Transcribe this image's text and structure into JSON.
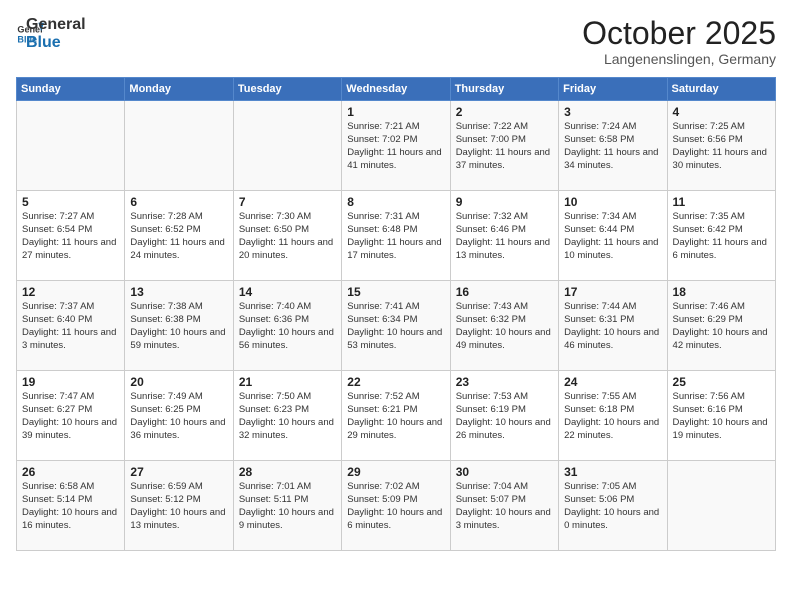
{
  "header": {
    "logo_general": "General",
    "logo_blue": "Blue",
    "month": "October 2025",
    "location": "Langenenslingen, Germany"
  },
  "days_of_week": [
    "Sunday",
    "Monday",
    "Tuesday",
    "Wednesday",
    "Thursday",
    "Friday",
    "Saturday"
  ],
  "weeks": [
    [
      {
        "day": "",
        "info": ""
      },
      {
        "day": "",
        "info": ""
      },
      {
        "day": "",
        "info": ""
      },
      {
        "day": "1",
        "info": "Sunrise: 7:21 AM\nSunset: 7:02 PM\nDaylight: 11 hours and 41 minutes."
      },
      {
        "day": "2",
        "info": "Sunrise: 7:22 AM\nSunset: 7:00 PM\nDaylight: 11 hours and 37 minutes."
      },
      {
        "day": "3",
        "info": "Sunrise: 7:24 AM\nSunset: 6:58 PM\nDaylight: 11 hours and 34 minutes."
      },
      {
        "day": "4",
        "info": "Sunrise: 7:25 AM\nSunset: 6:56 PM\nDaylight: 11 hours and 30 minutes."
      }
    ],
    [
      {
        "day": "5",
        "info": "Sunrise: 7:27 AM\nSunset: 6:54 PM\nDaylight: 11 hours and 27 minutes."
      },
      {
        "day": "6",
        "info": "Sunrise: 7:28 AM\nSunset: 6:52 PM\nDaylight: 11 hours and 24 minutes."
      },
      {
        "day": "7",
        "info": "Sunrise: 7:30 AM\nSunset: 6:50 PM\nDaylight: 11 hours and 20 minutes."
      },
      {
        "day": "8",
        "info": "Sunrise: 7:31 AM\nSunset: 6:48 PM\nDaylight: 11 hours and 17 minutes."
      },
      {
        "day": "9",
        "info": "Sunrise: 7:32 AM\nSunset: 6:46 PM\nDaylight: 11 hours and 13 minutes."
      },
      {
        "day": "10",
        "info": "Sunrise: 7:34 AM\nSunset: 6:44 PM\nDaylight: 11 hours and 10 minutes."
      },
      {
        "day": "11",
        "info": "Sunrise: 7:35 AM\nSunset: 6:42 PM\nDaylight: 11 hours and 6 minutes."
      }
    ],
    [
      {
        "day": "12",
        "info": "Sunrise: 7:37 AM\nSunset: 6:40 PM\nDaylight: 11 hours and 3 minutes."
      },
      {
        "day": "13",
        "info": "Sunrise: 7:38 AM\nSunset: 6:38 PM\nDaylight: 10 hours and 59 minutes."
      },
      {
        "day": "14",
        "info": "Sunrise: 7:40 AM\nSunset: 6:36 PM\nDaylight: 10 hours and 56 minutes."
      },
      {
        "day": "15",
        "info": "Sunrise: 7:41 AM\nSunset: 6:34 PM\nDaylight: 10 hours and 53 minutes."
      },
      {
        "day": "16",
        "info": "Sunrise: 7:43 AM\nSunset: 6:32 PM\nDaylight: 10 hours and 49 minutes."
      },
      {
        "day": "17",
        "info": "Sunrise: 7:44 AM\nSunset: 6:31 PM\nDaylight: 10 hours and 46 minutes."
      },
      {
        "day": "18",
        "info": "Sunrise: 7:46 AM\nSunset: 6:29 PM\nDaylight: 10 hours and 42 minutes."
      }
    ],
    [
      {
        "day": "19",
        "info": "Sunrise: 7:47 AM\nSunset: 6:27 PM\nDaylight: 10 hours and 39 minutes."
      },
      {
        "day": "20",
        "info": "Sunrise: 7:49 AM\nSunset: 6:25 PM\nDaylight: 10 hours and 36 minutes."
      },
      {
        "day": "21",
        "info": "Sunrise: 7:50 AM\nSunset: 6:23 PM\nDaylight: 10 hours and 32 minutes."
      },
      {
        "day": "22",
        "info": "Sunrise: 7:52 AM\nSunset: 6:21 PM\nDaylight: 10 hours and 29 minutes."
      },
      {
        "day": "23",
        "info": "Sunrise: 7:53 AM\nSunset: 6:19 PM\nDaylight: 10 hours and 26 minutes."
      },
      {
        "day": "24",
        "info": "Sunrise: 7:55 AM\nSunset: 6:18 PM\nDaylight: 10 hours and 22 minutes."
      },
      {
        "day": "25",
        "info": "Sunrise: 7:56 AM\nSunset: 6:16 PM\nDaylight: 10 hours and 19 minutes."
      }
    ],
    [
      {
        "day": "26",
        "info": "Sunrise: 6:58 AM\nSunset: 5:14 PM\nDaylight: 10 hours and 16 minutes."
      },
      {
        "day": "27",
        "info": "Sunrise: 6:59 AM\nSunset: 5:12 PM\nDaylight: 10 hours and 13 minutes."
      },
      {
        "day": "28",
        "info": "Sunrise: 7:01 AM\nSunset: 5:11 PM\nDaylight: 10 hours and 9 minutes."
      },
      {
        "day": "29",
        "info": "Sunrise: 7:02 AM\nSunset: 5:09 PM\nDaylight: 10 hours and 6 minutes."
      },
      {
        "day": "30",
        "info": "Sunrise: 7:04 AM\nSunset: 5:07 PM\nDaylight: 10 hours and 3 minutes."
      },
      {
        "day": "31",
        "info": "Sunrise: 7:05 AM\nSunset: 5:06 PM\nDaylight: 10 hours and 0 minutes."
      },
      {
        "day": "",
        "info": ""
      }
    ]
  ]
}
